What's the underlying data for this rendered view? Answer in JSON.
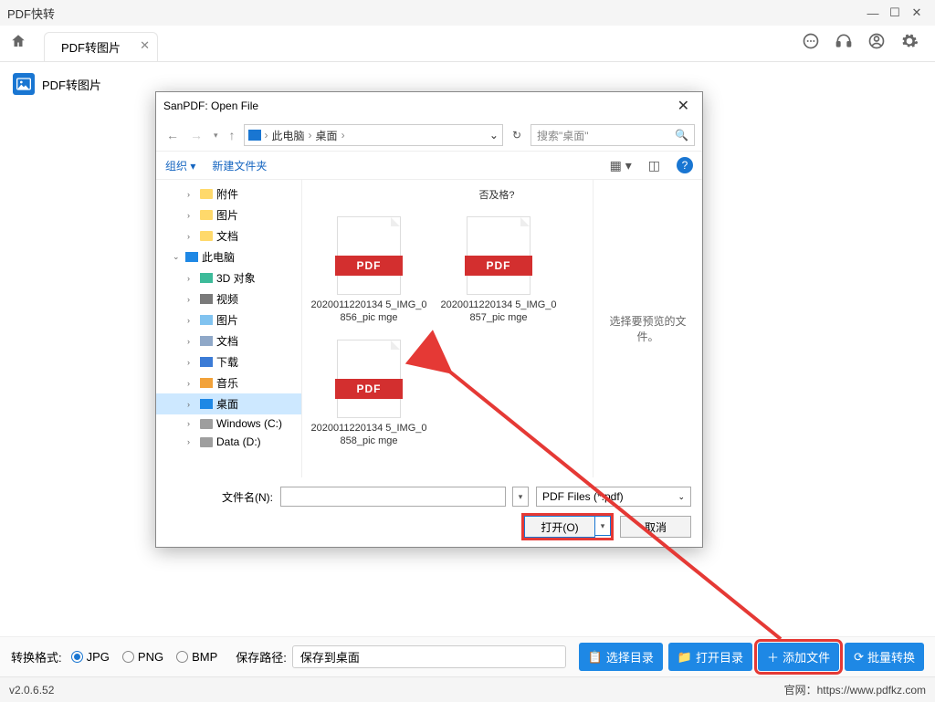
{
  "app": {
    "title": "PDF快转",
    "tab_label": "PDF转图片",
    "sidebar_label": "PDF转图片"
  },
  "dialog": {
    "title": "SanPDF: Open File",
    "crumb_pc": "此电脑",
    "crumb_desktop": "桌面",
    "search_placeholder": "搜索\"桌面\"",
    "organize": "组织",
    "new_folder": "新建文件夹",
    "truncated_text": "否及格?",
    "preview_hint": "选择要预览的文件。",
    "filename_label": "文件名(N):",
    "type_filter": "PDF Files (*.pdf)",
    "open_btn": "打开(O)",
    "cancel_btn": "取消",
    "tree": {
      "attachments": "附件",
      "pictures_q": "图片",
      "documents_q": "文档",
      "this_pc": "此电脑",
      "objects3d": "3D 对象",
      "videos": "视频",
      "pictures": "图片",
      "documents": "文档",
      "downloads": "下载",
      "music": "音乐",
      "desktop": "桌面",
      "drive_c": "Windows (C:)",
      "drive_d": "Data (D:)"
    },
    "files": [
      {
        "name": "2020011220134\n5_IMG_0856_pic\nmge"
      },
      {
        "name": "2020011220134\n5_IMG_0857_pic\nmge"
      },
      {
        "name": "2020011220134\n5_IMG_0858_pic\nmge"
      }
    ]
  },
  "bottom": {
    "format_label": "转换格式:",
    "fmt_jpg": "JPG",
    "fmt_png": "PNG",
    "fmt_bmp": "BMP",
    "path_label": "保存路径:",
    "path_value": "保存到桌面",
    "btn_choose_dir": "选择目录",
    "btn_open_dir": "打开目录",
    "btn_add_files": "添加文件",
    "btn_batch": "批量转换"
  },
  "status": {
    "version": "v2.0.6.52",
    "site_label": "官网：",
    "site_url": "https://www.pdfkz.com"
  }
}
